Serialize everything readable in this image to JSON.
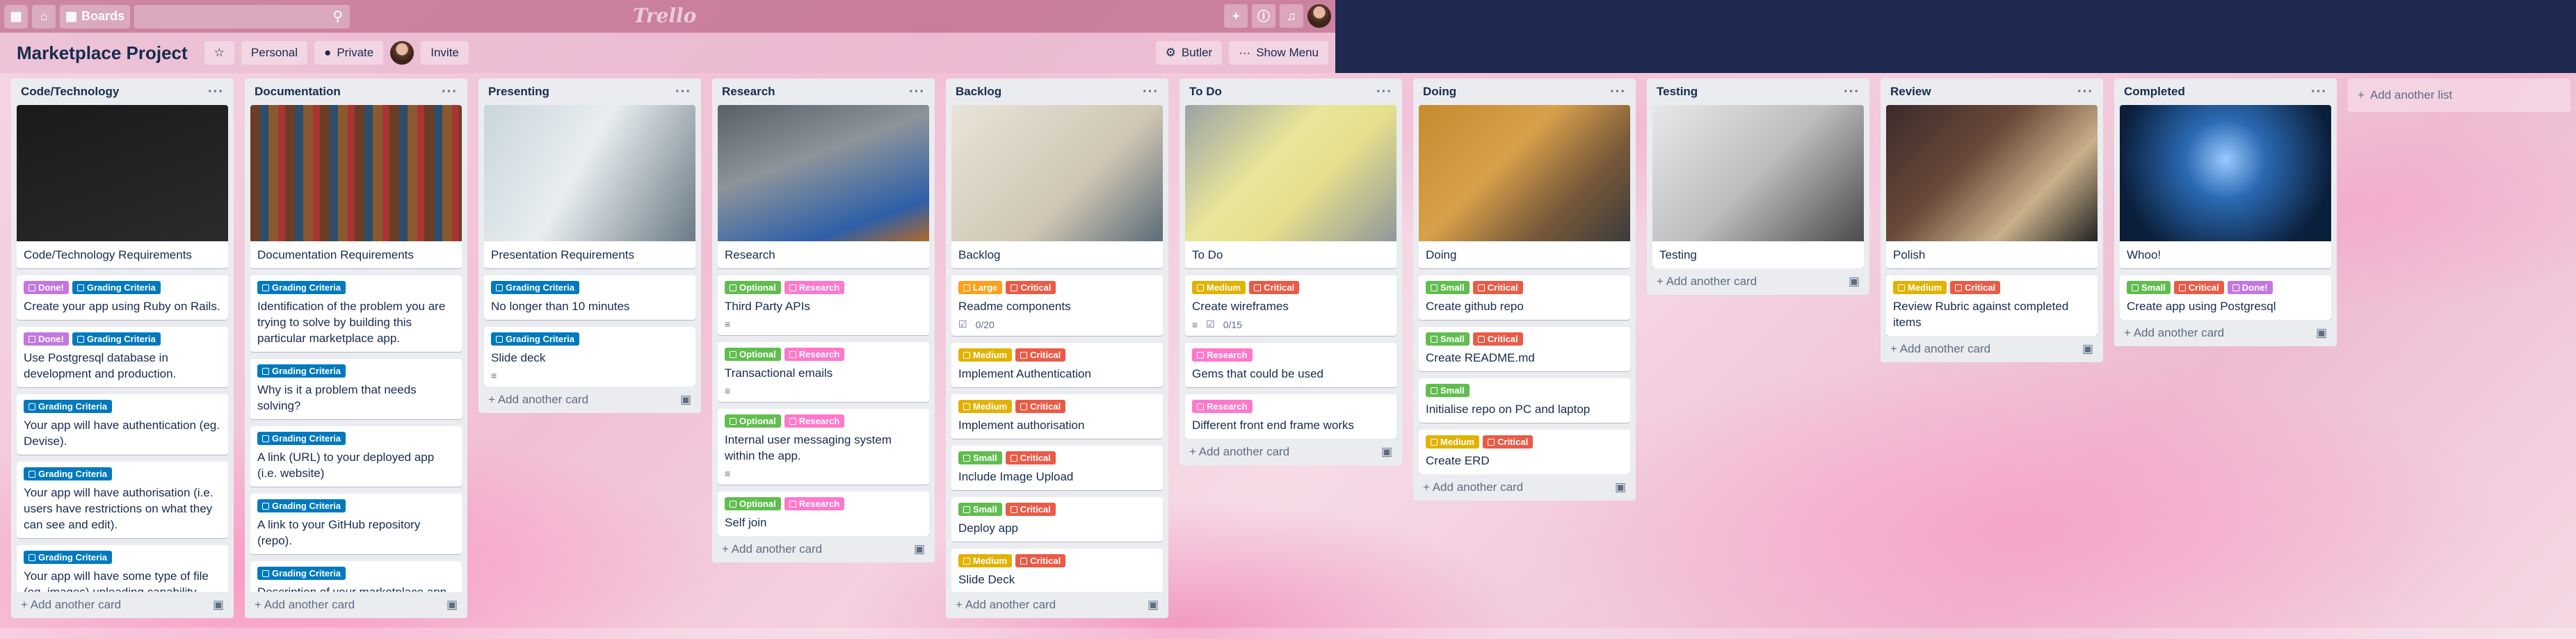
{
  "topbar": {
    "boards_label": "Boards",
    "logo": "Trello"
  },
  "board": {
    "title": "Marketplace Project",
    "personal": "Personal",
    "private": "Private",
    "invite": "Invite",
    "butler": "Butler",
    "show_menu": "Show Menu"
  },
  "add_card_label": "Add another card",
  "add_list_label": "Add another list",
  "colors": {
    "green": "#61bd4f",
    "red": "#eb5a46",
    "orange": "#ff9f1a",
    "blue": "#0079bf",
    "pink": "#ff78cb",
    "purple": "#c377e0",
    "yellow": "#e2b203"
  },
  "lists": [
    {
      "title": "Code/Technology",
      "cards": [
        {
          "title": "Code/Technology Requirements",
          "cover": "code"
        },
        {
          "labels": [
            [
              "Done!",
              "purple"
            ],
            [
              "Grading Criteria",
              "blue"
            ]
          ],
          "title": "Create your app using Ruby on Rails."
        },
        {
          "labels": [
            [
              "Done!",
              "purple"
            ],
            [
              "Grading Criteria",
              "blue"
            ]
          ],
          "title": "Use Postgresql database in development and production."
        },
        {
          "labels": [
            [
              "Grading Criteria",
              "blue"
            ]
          ],
          "title": "Your app will have authentication (eg. Devise)."
        },
        {
          "labels": [
            [
              "Grading Criteria",
              "blue"
            ]
          ],
          "title": "Your app will have authorisation (i.e. users have restrictions on what they can see and edit)."
        },
        {
          "labels": [
            [
              "Grading Criteria",
              "blue"
            ]
          ],
          "title": "Your app will have some type of file (eg. images) uploading capability."
        }
      ]
    },
    {
      "title": "Documentation",
      "cards": [
        {
          "title": "Documentation Requirements",
          "cover": "books"
        },
        {
          "labels": [
            [
              "Grading Criteria",
              "blue"
            ]
          ],
          "title": "Identification of the problem you are trying to solve by building this particular marketplace app."
        },
        {
          "labels": [
            [
              "Grading Criteria",
              "blue"
            ]
          ],
          "title": "Why is it a problem that needs solving?"
        },
        {
          "labels": [
            [
              "Grading Criteria",
              "blue"
            ]
          ],
          "title": "A link (URL) to your deployed app (i.e. website)"
        },
        {
          "labels": [
            [
              "Grading Criteria",
              "blue"
            ]
          ],
          "title": "A link to your GitHub repository (repo)."
        },
        {
          "labels": [
            [
              "Grading Criteria",
              "blue"
            ]
          ],
          "title": "Description of your marketplace app"
        }
      ]
    },
    {
      "title": "Presenting",
      "cards": [
        {
          "title": "Presentation Requirements",
          "cover": "present"
        },
        {
          "labels": [
            [
              "Grading Criteria",
              "blue"
            ]
          ],
          "title": "No longer than 10 minutes"
        },
        {
          "labels": [
            [
              "Grading Criteria",
              "blue"
            ]
          ],
          "title": "Slide deck",
          "desc": true
        }
      ]
    },
    {
      "title": "Research",
      "cards": [
        {
          "title": "Research",
          "cover": "lab"
        },
        {
          "labels": [
            [
              "Optional",
              "green"
            ],
            [
              "Research",
              "pink"
            ]
          ],
          "title": "Third Party APIs",
          "desc": true
        },
        {
          "labels": [
            [
              "Optional",
              "green"
            ],
            [
              "Research",
              "pink"
            ]
          ],
          "title": "Transactional emails",
          "desc": true
        },
        {
          "labels": [
            [
              "Optional",
              "green"
            ],
            [
              "Research",
              "pink"
            ]
          ],
          "title": "Internal user messaging system within the app.",
          "desc": true
        },
        {
          "labels": [
            [
              "Optional",
              "green"
            ],
            [
              "Research",
              "pink"
            ]
          ],
          "title": "Self join"
        }
      ]
    },
    {
      "title": "Backlog",
      "cards": [
        {
          "title": "Backlog",
          "cover": "notebook"
        },
        {
          "labels": [
            [
              "Large",
              "orange"
            ],
            [
              "Critical",
              "red"
            ]
          ],
          "title": "Readme components",
          "check": "0/20"
        },
        {
          "labels": [
            [
              "Medium",
              "yellow"
            ],
            [
              "Critical",
              "red"
            ]
          ],
          "title": "Implement Authentication"
        },
        {
          "labels": [
            [
              "Medium",
              "yellow"
            ],
            [
              "Critical",
              "red"
            ]
          ],
          "title": "Implement authorisation"
        },
        {
          "labels": [
            [
              "Small",
              "green"
            ],
            [
              "Critical",
              "red"
            ]
          ],
          "title": "Include Image Upload"
        },
        {
          "labels": [
            [
              "Small",
              "green"
            ],
            [
              "Critical",
              "red"
            ]
          ],
          "title": "Deploy app"
        },
        {
          "labels": [
            [
              "Medium",
              "yellow"
            ],
            [
              "Critical",
              "red"
            ]
          ],
          "title": "Slide Deck"
        }
      ]
    },
    {
      "title": "To Do",
      "cards": [
        {
          "title": "To Do",
          "cover": "sticky"
        },
        {
          "labels": [
            [
              "Medium",
              "yellow"
            ],
            [
              "Critical",
              "red"
            ]
          ],
          "title": "Create wireframes",
          "desc": true,
          "check": "0/15"
        },
        {
          "labels": [
            [
              "Research",
              "pink"
            ]
          ],
          "title": "Gems that could be used"
        },
        {
          "labels": [
            [
              "Research",
              "pink"
            ]
          ],
          "title": "Different front end frame works"
        }
      ]
    },
    {
      "title": "Doing",
      "cards": [
        {
          "title": "Doing",
          "cover": "laptop"
        },
        {
          "labels": [
            [
              "Small",
              "green"
            ],
            [
              "Critical",
              "red"
            ]
          ],
          "title": "Create github repo"
        },
        {
          "labels": [
            [
              "Small",
              "green"
            ],
            [
              "Critical",
              "red"
            ]
          ],
          "title": "Create README.md"
        },
        {
          "labels": [
            [
              "Small",
              "green"
            ]
          ],
          "title": "Initialise repo on PC and laptop"
        },
        {
          "labels": [
            [
              "Medium",
              "yellow"
            ],
            [
              "Critical",
              "red"
            ]
          ],
          "title": "Create ERD"
        }
      ]
    },
    {
      "title": "Testing",
      "cards": [
        {
          "title": "Testing",
          "cover": "phone"
        }
      ]
    },
    {
      "title": "Review",
      "cards": [
        {
          "title": "Polish",
          "cover": "polish"
        },
        {
          "labels": [
            [
              "Medium",
              "yellow"
            ],
            [
              "Critical",
              "red"
            ]
          ],
          "title": "Review Rubric against completed items"
        }
      ]
    },
    {
      "title": "Completed",
      "cards": [
        {
          "title": "Whoo!",
          "cover": "confetti"
        },
        {
          "labels": [
            [
              "Small",
              "green"
            ],
            [
              "Critical",
              "red"
            ],
            [
              "Done!",
              "purple"
            ]
          ],
          "title": "Create app using Postgresql"
        }
      ]
    }
  ]
}
